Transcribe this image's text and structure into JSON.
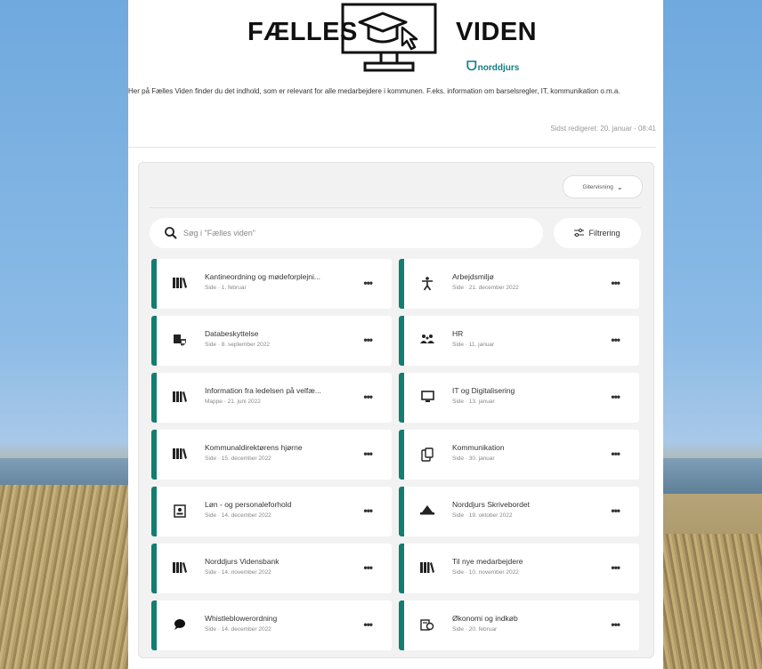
{
  "banner": {
    "word_left": "FÆLLES",
    "word_right": "VIDEN",
    "brand": "norddjurs"
  },
  "intro": "Her på Fælles Viden finder du det indhold, som er relevant for alle medarbejdere i kommunen. F.eks. information om barselsregler, IT, kommunikation o.m.a.",
  "last_edited": "Sidst redigeret: 20. januar - 08:41",
  "toolbar": {
    "view_label": "Gitervisning",
    "search_placeholder": "Søg i \"Fælles viden\"",
    "filter_label": "Filtrering"
  },
  "cards": [
    {
      "icon": "library-icon",
      "title": "Kantineordning og mødeforplejni...",
      "meta": "Side · 1. februar"
    },
    {
      "icon": "accessibility-icon",
      "title": "Arbejdsmiljø",
      "meta": "Side · 21. december 2022"
    },
    {
      "icon": "data-protection-icon",
      "title": "Databeskyttelse",
      "meta": "Side · 8. september 2022"
    },
    {
      "icon": "people-icon",
      "title": "HR",
      "meta": "Side · 11. januar"
    },
    {
      "icon": "library-icon",
      "title": "Information fra ledelsen på velfæ...",
      "meta": "Mappe · 21. juni 2022"
    },
    {
      "icon": "monitor-icon",
      "title": "IT og Digitalisering",
      "meta": "Side · 13. januar"
    },
    {
      "icon": "library-icon",
      "title": "Kommunaldirektørens hjørne",
      "meta": "Side · 15. december 2022"
    },
    {
      "icon": "clipboard-icon",
      "title": "Kommunikation",
      "meta": "Side · 30. januar"
    },
    {
      "icon": "id-card-icon",
      "title": "Løn - og personaleforhold",
      "meta": "Side · 14. december 2022"
    },
    {
      "icon": "desk-icon",
      "title": "Norddjurs Skrivebordet",
      "meta": "Side · 19. oktober 2022"
    },
    {
      "icon": "library-icon",
      "title": "Norddjurs Vidensbank",
      "meta": "Side · 14. november 2022"
    },
    {
      "icon": "library-icon",
      "title": "Til nye medarbejdere",
      "meta": "Side · 10. november 2022"
    },
    {
      "icon": "speech-bubble-icon",
      "title": "Whistleblowerordning",
      "meta": "Side · 14. december 2022"
    },
    {
      "icon": "money-icon",
      "title": "Økonomi og indkøb",
      "meta": "Side · 20. februar"
    }
  ],
  "more_label": "•••"
}
